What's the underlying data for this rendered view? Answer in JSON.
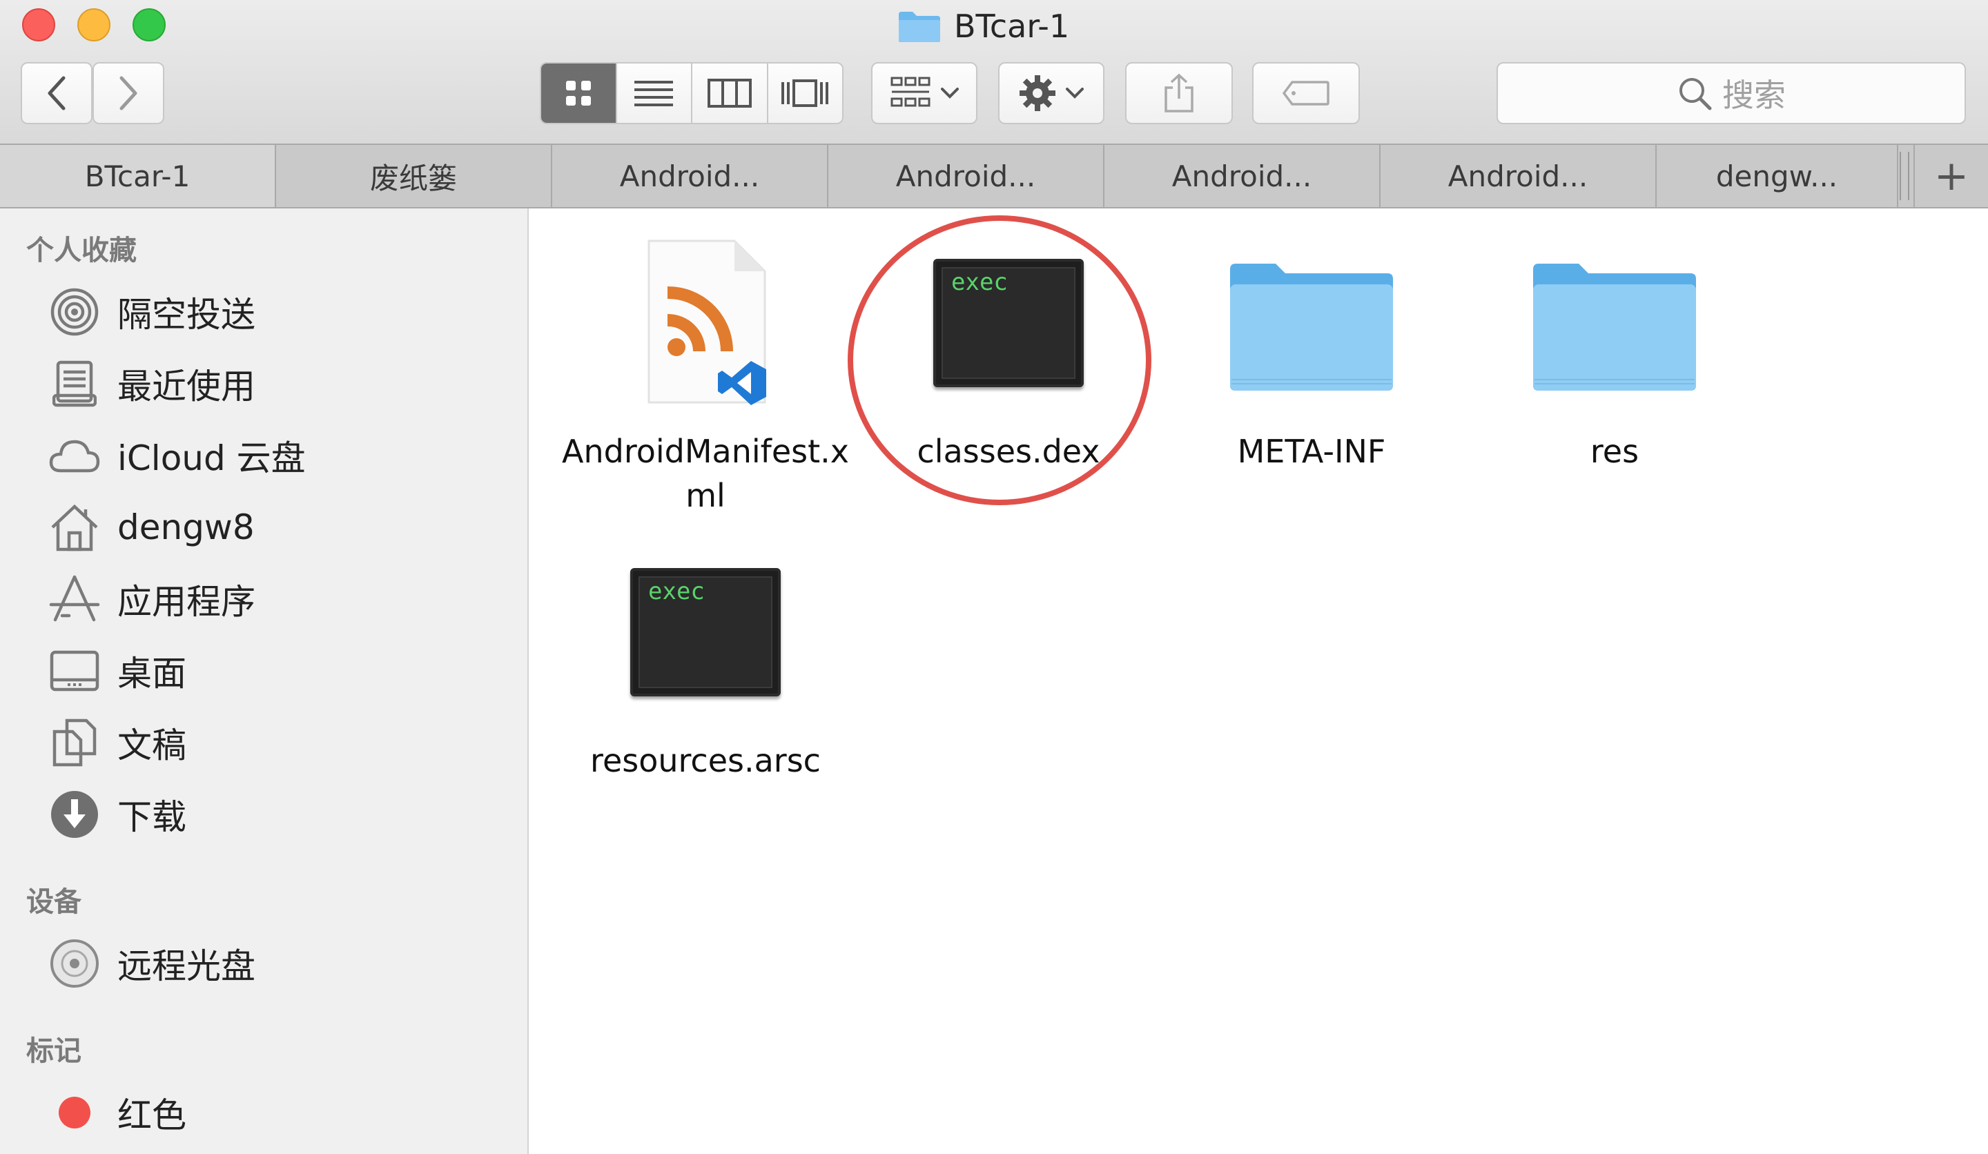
{
  "window": {
    "title": "BTcar-1",
    "search_placeholder": "搜索"
  },
  "toolbar": {
    "back_icon": "chevron-left-icon",
    "forward_icon": "chevron-right-icon",
    "view_modes": [
      "icon-view",
      "list-view",
      "column-view",
      "cover-flow-view"
    ],
    "active_view": "icon-view",
    "group_icon": "group-icon",
    "action_icon": "gear-icon",
    "share_icon": "share-icon",
    "tag_icon": "tag-icon"
  },
  "tabs": [
    {
      "label": "BTcar-1",
      "active": true
    },
    {
      "label": "废纸篓",
      "active": false
    },
    {
      "label": "Android...",
      "active": false
    },
    {
      "label": "Android...",
      "active": false
    },
    {
      "label": "Android...",
      "active": false
    },
    {
      "label": "Android...",
      "active": false
    },
    {
      "label": "dengw...",
      "active": false
    }
  ],
  "tab_add_label": "+",
  "sidebar": {
    "favorites_header": "个人收藏",
    "favorites": [
      {
        "label": "隔空投送",
        "icon": "airdrop-icon"
      },
      {
        "label": "最近使用",
        "icon": "recents-icon"
      },
      {
        "label": "iCloud 云盘",
        "icon": "icloud-icon"
      },
      {
        "label": "dengw8",
        "icon": "home-icon"
      },
      {
        "label": "应用程序",
        "icon": "applications-icon"
      },
      {
        "label": "桌面",
        "icon": "desktop-icon"
      },
      {
        "label": "文稿",
        "icon": "documents-icon"
      },
      {
        "label": "下载",
        "icon": "downloads-icon"
      }
    ],
    "devices_header": "设备",
    "devices": [
      {
        "label": "远程光盘",
        "icon": "remote-disc-icon"
      }
    ],
    "tags_header": "标记",
    "tags": [
      {
        "label": "红色",
        "color": "#f2504a"
      }
    ]
  },
  "files": [
    {
      "name": "AndroidManifest.xml",
      "kind": "xml-file-icon"
    },
    {
      "name": "classes.dex",
      "kind": "exec-file-icon",
      "badge": "exec",
      "highlighted": true
    },
    {
      "name": "META-INF",
      "kind": "folder-icon"
    },
    {
      "name": "res",
      "kind": "folder-icon"
    },
    {
      "name": "resources.arsc",
      "kind": "exec-file-icon",
      "badge": "exec"
    }
  ],
  "colors": {
    "highlight": "#e0504a",
    "folder": "#69b8ef",
    "rss_orange": "#e17b2e",
    "vscode_blue": "#1f7ad6",
    "exec_green": "#59d36b"
  }
}
